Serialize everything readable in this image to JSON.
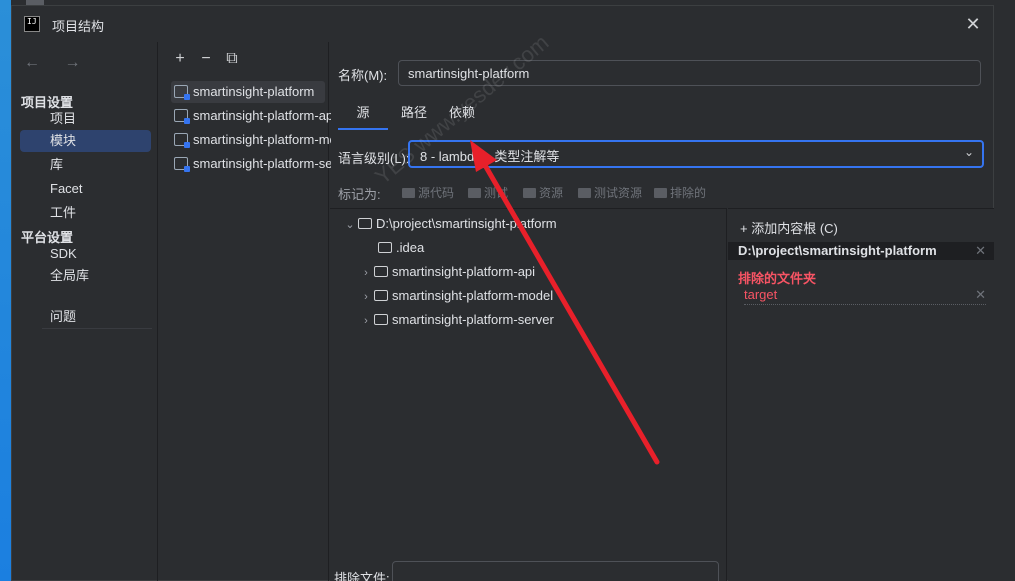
{
  "window": {
    "title": "项目结构",
    "app_icon_text": "IJ"
  },
  "nav": {
    "back_forward": "← →",
    "groups": [
      {
        "label": "项目设置",
        "items": [
          "项目",
          "模块",
          "库",
          "Facet",
          "工件"
        ]
      },
      {
        "label": "平台设置",
        "items": [
          "SDK",
          "全局库"
        ]
      }
    ],
    "extra": [
      "问题"
    ],
    "selected": "模块"
  },
  "modules": {
    "toolbar": [
      "+",
      "−",
      "⧉"
    ],
    "items": [
      "smartinsight-platform",
      "smartinsight-platform-api",
      "smartinsight-platform-model",
      "smartinsight-platform-server"
    ],
    "selected": "smartinsight-platform"
  },
  "content": {
    "name_label": "名称(M):",
    "name_value": "smartinsight-platform",
    "tabs": [
      "源",
      "路径",
      "依赖"
    ],
    "active_tab": "源",
    "lang_label": "语言级别(L):",
    "lang_value": "8 - lambda、类型注解等",
    "mark_label": "标记为:",
    "mark_buttons": [
      "源代码",
      "测试",
      "资源",
      "测试资源",
      "排除的"
    ],
    "tree": {
      "root": "D:\\project\\smartinsight-platform",
      "children": [
        {
          "name": ".idea",
          "expandable": false
        },
        {
          "name": "smartinsight-platform-api",
          "expandable": true
        },
        {
          "name": "smartinsight-platform-model",
          "expandable": true
        },
        {
          "name": "smartinsight-platform-server",
          "expandable": true
        }
      ]
    },
    "content_root": {
      "add_label": "添加内容根 (C)",
      "path": "D:\\project\\smartinsight-platform",
      "excluded_title": "排除的文件夹",
      "excluded": [
        "target"
      ]
    },
    "exclude_files_label": "排除文件:",
    "exclude_files_value": ""
  },
  "watermark": "YES www.yesdev.com",
  "colors": {
    "accent": "#3574f0",
    "selection": "#2e436e",
    "excluded": "#f75464",
    "arrow": "#e8202a"
  }
}
